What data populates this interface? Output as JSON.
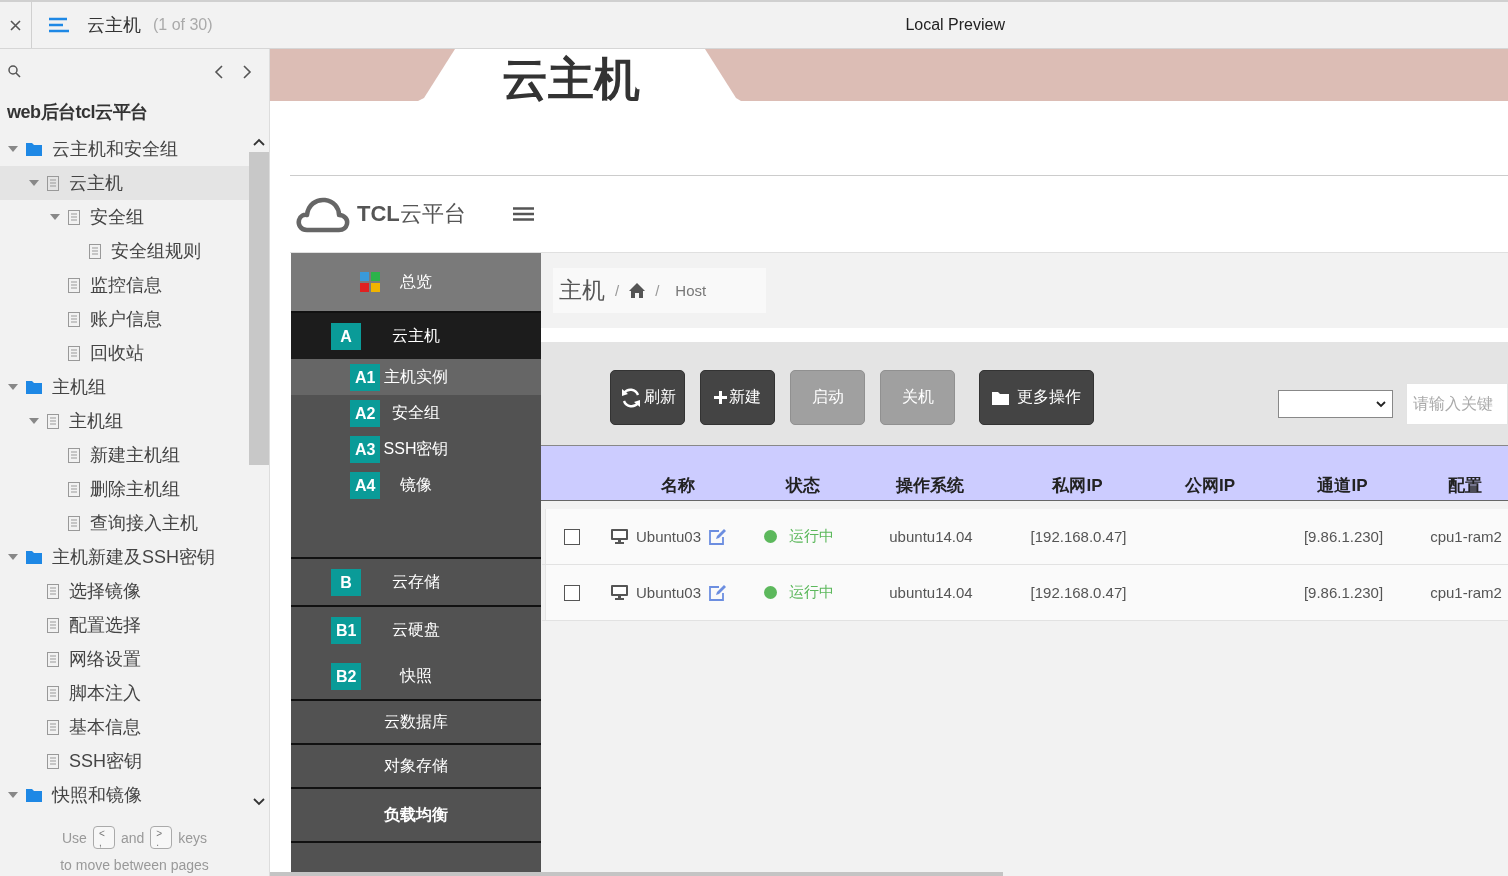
{
  "topbar": {
    "title": "云主机",
    "page_count": "(1 of 30)",
    "preview_title": "Local Preview"
  },
  "sidebar": {
    "heading": "web后台tcl云平台",
    "tree": [
      {
        "label": "云主机和安全组",
        "kind": "folder",
        "expanded": true,
        "selected": false,
        "children": [
          {
            "label": "云主机",
            "kind": "page",
            "expanded": true,
            "selected": true,
            "children": [
              {
                "label": "安全组",
                "kind": "page",
                "expanded": true,
                "selected": false,
                "children": [
                  {
                    "label": "安全组规则",
                    "kind": "page",
                    "selected": false
                  }
                ]
              },
              {
                "label": "监控信息",
                "kind": "page",
                "selected": false
              },
              {
                "label": "账户信息",
                "kind": "page",
                "selected": false
              },
              {
                "label": "回收站",
                "kind": "page",
                "selected": false
              }
            ]
          }
        ]
      },
      {
        "label": "主机组",
        "kind": "folder",
        "expanded": true,
        "selected": false,
        "children": [
          {
            "label": "主机组",
            "kind": "page",
            "expanded": true,
            "selected": false,
            "children": [
              {
                "label": "新建主机组",
                "kind": "page",
                "selected": false
              },
              {
                "label": "删除主机组",
                "kind": "page",
                "selected": false
              },
              {
                "label": "查询接入主机",
                "kind": "page",
                "selected": false
              }
            ]
          }
        ]
      },
      {
        "label": "主机新建及SSH密钥",
        "kind": "folder",
        "expanded": true,
        "selected": false,
        "children": [
          {
            "label": "选择镜像",
            "kind": "page",
            "selected": false
          },
          {
            "label": "配置选择",
            "kind": "page",
            "selected": false
          },
          {
            "label": "网络设置",
            "kind": "page",
            "selected": false
          },
          {
            "label": "脚本注入",
            "kind": "page",
            "selected": false
          },
          {
            "label": "基本信息",
            "kind": "page",
            "selected": false
          },
          {
            "label": "SSH密钥",
            "kind": "page",
            "selected": false
          }
        ]
      },
      {
        "label": "快照和镜像",
        "kind": "folder",
        "expanded": true,
        "selected": false
      }
    ],
    "hint": {
      "use": "Use",
      "key_prev": {
        "upper": "<",
        "lower": ","
      },
      "and": "and",
      "key_next": {
        "upper": ">",
        "lower": "."
      },
      "keys": "keys",
      "line2": "to move between pages"
    }
  },
  "preview": {
    "banner_title": "云主机",
    "logo_text": "**TCL**云平台",
    "nav": [
      {
        "items": [
          {
            "kind": "overview",
            "label": "总览"
          }
        ]
      },
      {
        "items": [
          {
            "kind": "section",
            "badge": "A",
            "label": "云主机",
            "selected": true
          },
          {
            "kind": "sub",
            "badge": "A1",
            "label": "主机实例",
            "selected": true
          },
          {
            "kind": "sub",
            "badge": "A2",
            "label": "安全组",
            "selected": false
          },
          {
            "kind": "sub",
            "badge": "A3",
            "label": "SSH密钥",
            "selected": false
          },
          {
            "kind": "sub",
            "badge": "A4",
            "label": "镜像",
            "selected": false
          }
        ]
      },
      {
        "items": [
          {
            "kind": "section",
            "badge": "B",
            "label": "云存储",
            "selected": false
          }
        ]
      },
      {
        "items": [
          {
            "kind": "section",
            "badge": "B1",
            "label": "云硬盘",
            "selected": false
          },
          {
            "kind": "section",
            "badge": "B2",
            "label": "快照",
            "selected": false
          }
        ]
      },
      {
        "items": [
          {
            "kind": "plain",
            "label": "云数据库"
          }
        ]
      },
      {
        "items": [
          {
            "kind": "plain",
            "label": "对象存储"
          }
        ]
      },
      {
        "items": [
          {
            "kind": "strong",
            "label": "负载均衡"
          }
        ]
      }
    ],
    "breadcrumb": [
      {
        "kind": "title",
        "text": "主机"
      },
      {
        "kind": "separator",
        "text": "/"
      },
      {
        "kind": "home"
      },
      {
        "kind": "separator",
        "text": "/"
      },
      {
        "kind": "link",
        "text": "Host"
      }
    ],
    "toolbar": {
      "buttons": [
        {
          "label": "刷新",
          "kind": "refresh",
          "disabled": false
        },
        {
          "label": "新建",
          "kind": "add",
          "disabled": false
        },
        {
          "label": "启动",
          "kind": "action",
          "disabled": true
        },
        {
          "label": "关机",
          "kind": "action",
          "disabled": true
        },
        {
          "label": "更多操作",
          "kind": "menu",
          "disabled": false
        }
      ],
      "search": {
        "placeholder": "请输入关键"
      }
    },
    "table": {
      "columns": [
        "名称",
        "状态",
        "操作系统",
        "私网IP",
        "公网IP",
        "通道IP",
        "配置"
      ],
      "rows": [
        {
          "checked": false,
          "name": "Ubuntu03",
          "status": "运行中",
          "color": "#5cb85c",
          "os": "ubuntu14.04",
          "private_ip": "[192.168.0.47]",
          "channel_ip": "[9.86.1.230]",
          "config": "cpu1-ram2"
        },
        {
          "checked": false,
          "name": "Ubuntu03",
          "status": "运行中",
          "color": "#5cb85c",
          "os": "ubuntu14.04",
          "private_ip": "[192.168.0.47]",
          "channel_ip": "[9.86.1.230]",
          "config": "cpu1-ram2"
        }
      ]
    }
  }
}
